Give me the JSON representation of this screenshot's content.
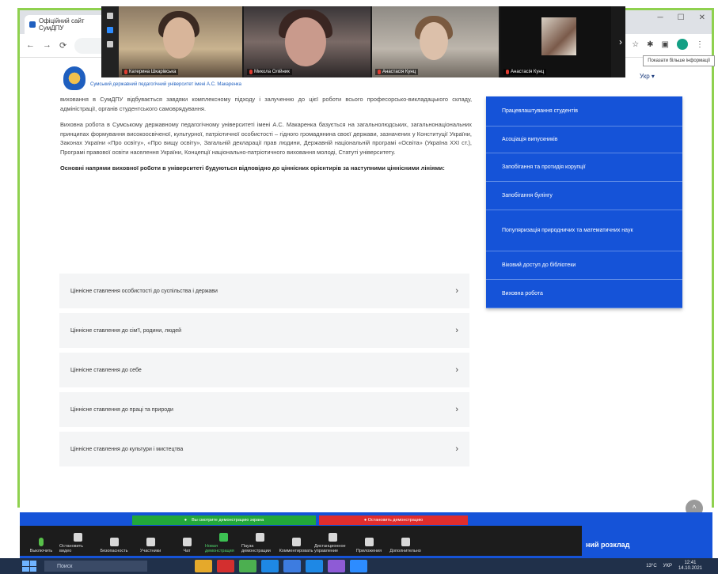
{
  "browser": {
    "tab_title": "Офіційний сайт СумДПУ",
    "nav": [
      "←",
      "→",
      "⟳"
    ],
    "win_controls": [
      "─",
      "☐",
      "✕"
    ],
    "tooltip": "Показати більше інформації"
  },
  "zoom_strip": {
    "participants": [
      {
        "name": "Катерина Шкарівська"
      },
      {
        "name": "Микола Олійник"
      },
      {
        "name": "Анастасія Кунц"
      },
      {
        "name": "Анастасія Кунц"
      }
    ],
    "next_arrow": "›"
  },
  "site": {
    "name": "Сумський державний педагогічний університет імені А.С. Макаренка",
    "lang": "Укр ▾",
    "paragraphs": [
      {
        "text": "виховання в СумДПУ відбувається завдяки комплексному підходу і залученню до цієї роботи всього професорсько-викладацького складу, адміністрації, органів студентського самоврядування."
      },
      {
        "text": "Виховна робота в Сумському державному педагогічному університеті імені А.С. Макаренка базується на загальнолюдських, загальнонаціональних принципах формування високоосвіченої, культурної, патріотичної особистості – гідного громадянина своєї держави, зазначених у Конституції України, Законах України «Про освіту», «Про вищу освіту», Загальній декларації прав людини, Державній національній програмі «Освіта» (Україна XXI ст.), Програмі правової освіти населення України, Концепції національно-патріотичного виховання молоді, Статуті університету."
      },
      {
        "text": "Основні напрями виховної роботи в університеті будуються відповідно до ціннісних орієнтирів за наступними ціннісними лініями:",
        "bold": true
      }
    ],
    "accordion": [
      {
        "label": "Ціннісне ставлення особистості до суспільства і держави",
        "chev": "›"
      },
      {
        "label": "Ціннісне ставлення до сім'ї, родини, людей",
        "chev": "›"
      },
      {
        "label": "Ціннісне ставлення до себе",
        "chev": "›"
      },
      {
        "label": "Ціннісне ставлення до праці та природи",
        "chev": "›"
      },
      {
        "label": "Ціннісне ставлення до культури і мистецтва",
        "chev": "›"
      }
    ],
    "sidebar": [
      {
        "label": "Працевлаштування студентів",
        "h": 38
      },
      {
        "label": "Асоціація випускників",
        "h": 34
      },
      {
        "label": "Запобігання та протидія корупції",
        "h": 36
      },
      {
        "label": "Запобігання булінгу",
        "h": 36
      },
      {
        "label": "Популяризація природничих та математичних наук",
        "h": 52
      },
      {
        "label": "Віковий доступ до бібліотеки",
        "h": 36
      },
      {
        "label": "Виховна робота",
        "h": 36
      }
    ],
    "scroll_top": "^",
    "footer_text": "ний розклад"
  },
  "zoom_share": {
    "green_banner": "Вы смотрите демонстрацию экрана",
    "green_dot": "●",
    "red_banner": "● Остановить демонстрацию"
  },
  "zoom_toolbar": {
    "buttons": [
      {
        "label": "Выключить",
        "icon": "mic-icon"
      },
      {
        "label": "Остановить видео",
        "icon": "video-icon"
      },
      {
        "label": "Безопасность",
        "icon": "shield-icon"
      },
      {
        "label": "Участники",
        "icon": "participants-icon"
      },
      {
        "label": "Чат",
        "icon": "chat-icon"
      },
      {
        "label": "Новая демонстрация",
        "icon": "share-screen-icon",
        "accent": true
      },
      {
        "label": "Пауза демонстрации",
        "icon": "pause-icon"
      },
      {
        "label": "Комментировать",
        "icon": "annotate-icon"
      },
      {
        "label": "Дистанционное управление",
        "icon": "remote-control-icon"
      },
      {
        "label": "Приложения",
        "icon": "apps-icon"
      },
      {
        "label": "Дополнительно",
        "icon": "more-icon"
      }
    ]
  },
  "taskbar": {
    "search_placeholder": "Поиск",
    "apps": [
      {
        "name": "explorer-app",
        "color": "#e5a92b"
      },
      {
        "name": "opera-app",
        "color": "#d32f2f"
      },
      {
        "name": "chrome-app",
        "color": "#4caf50"
      },
      {
        "name": "edge-app",
        "color": "#1e88e5"
      },
      {
        "name": "app-4",
        "color": "#3d7ce0"
      },
      {
        "name": "app-5",
        "color": "#1e88e5"
      },
      {
        "name": "viber-app",
        "color": "#8e5bd6"
      },
      {
        "name": "zoom-app",
        "color": "#2d8cff"
      }
    ],
    "weather": "13°C",
    "lang": "УКР",
    "time": "12:41",
    "date": "14.10.2021"
  }
}
